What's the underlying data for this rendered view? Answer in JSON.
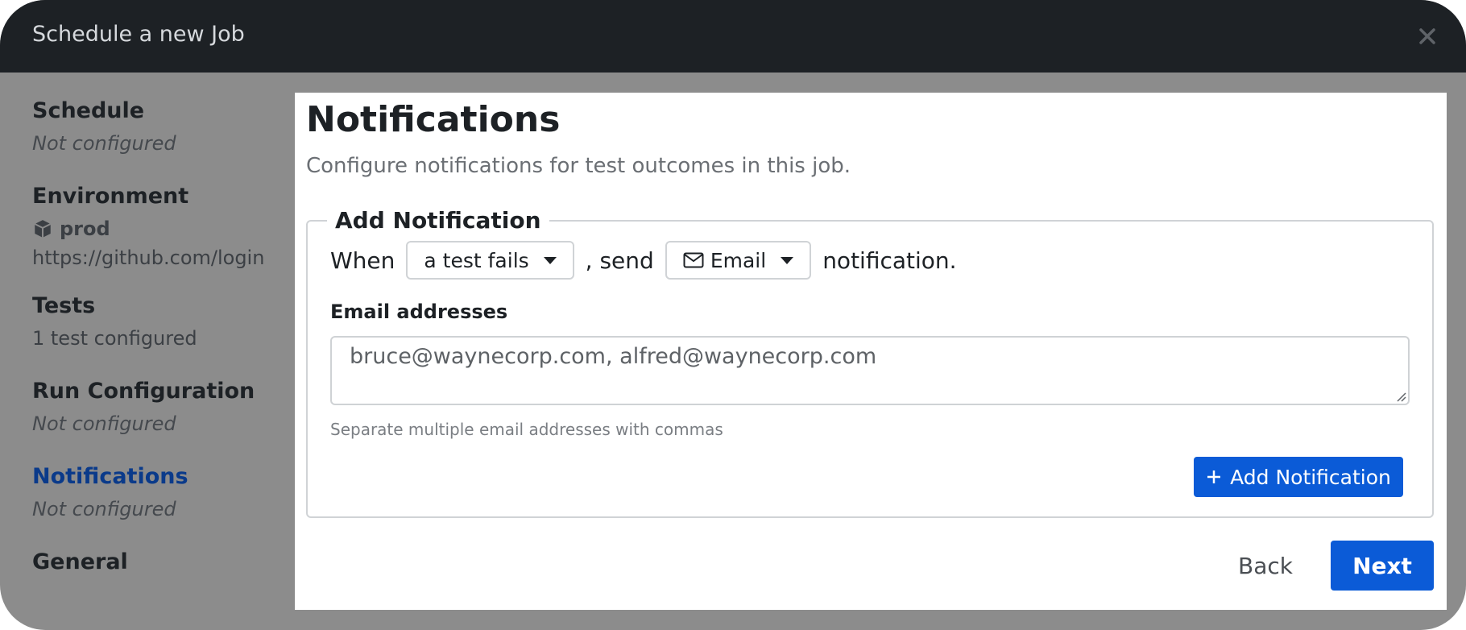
{
  "header": {
    "title": "Schedule a new Job",
    "close_icon": "close-icon"
  },
  "sidebar": {
    "schedule": {
      "title": "Schedule",
      "status": "Not configured"
    },
    "environment": {
      "title": "Environment",
      "name": "prod",
      "icon": "cube-icon",
      "url": "https://github.com/login"
    },
    "tests": {
      "title": "Tests",
      "status": "1 test configured"
    },
    "run_configuration": {
      "title": "Run Configuration",
      "status": "Not configured"
    },
    "notifications": {
      "title": "Notifications",
      "status": "Not configured",
      "active": true
    },
    "general": {
      "title": "General"
    }
  },
  "main": {
    "title": "Notifications",
    "description": "Configure notifications for test outcomes in this job.",
    "form": {
      "legend": "Add Notification",
      "when_label": "When",
      "trigger_value": "a test fails",
      "send_label": ", send",
      "channel_value": "Email",
      "channel_icon": "mail-icon",
      "suffix_label": "notification.",
      "email_label": "Email addresses",
      "email_value": "bruce@waynecorp.com, alfred@waynecorp.com",
      "help_text": "Separate multiple email addresses with commas",
      "add_button": "Add Notification"
    },
    "footer": {
      "back_label": "Back",
      "next_label": "Next"
    }
  },
  "colors": {
    "titlebar_bg": "#1d2125",
    "backdrop": "#8c8c8c",
    "primary": "#0b5bd7",
    "active_step": "#0a3a8a"
  }
}
